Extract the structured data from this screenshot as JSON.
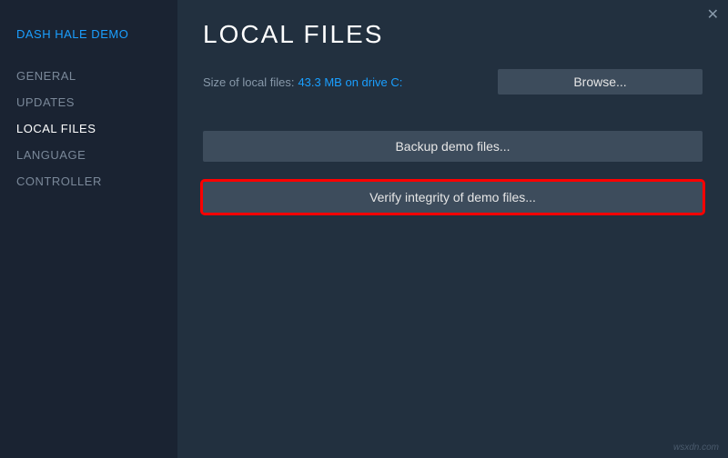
{
  "sidebar": {
    "title": "DASH HALE DEMO",
    "items": [
      {
        "label": "GENERAL",
        "active": false
      },
      {
        "label": "UPDATES",
        "active": false
      },
      {
        "label": "LOCAL FILES",
        "active": true
      },
      {
        "label": "LANGUAGE",
        "active": false
      },
      {
        "label": "CONTROLLER",
        "active": false
      }
    ]
  },
  "main": {
    "title": "LOCAL FILES",
    "sizeLabel": "Size of local files:",
    "sizeValue": "43.3 MB on drive C:",
    "browseLabel": "Browse...",
    "backupLabel": "Backup demo files...",
    "verifyLabel": "Verify integrity of demo files..."
  },
  "closeGlyph": "✕",
  "watermark": "wsxdn.com"
}
